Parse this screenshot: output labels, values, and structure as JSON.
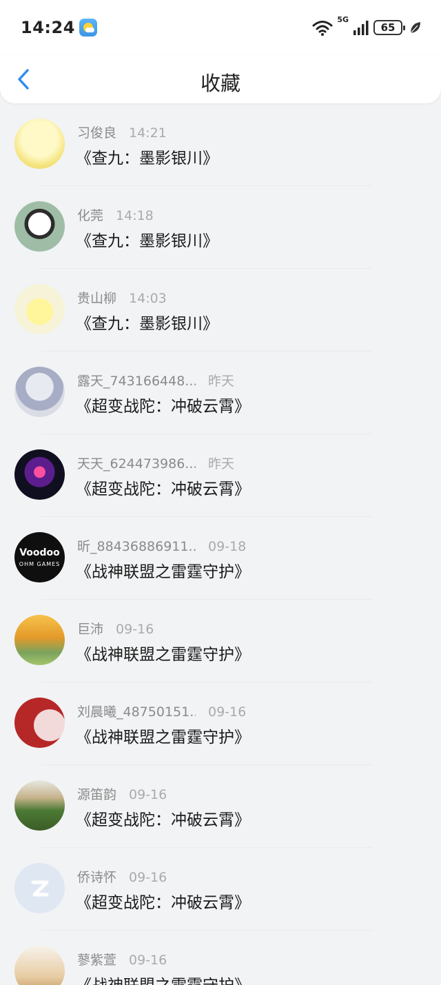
{
  "status_bar": {
    "time": "14:24",
    "weather_icon": "partly-cloudy-icon",
    "network": "5G",
    "battery": "65",
    "icons": [
      "wifi-icon",
      "signal-icon",
      "battery-icon",
      "leaf-icon"
    ]
  },
  "nav": {
    "back_icon": "chevron-left-icon",
    "title": "收藏"
  },
  "colors": {
    "accent": "#2f8cf0",
    "background": "#f2f3f5"
  },
  "items": [
    {
      "name": "习俊良",
      "time": "14:21",
      "title": "《查九：墨影银川》"
    },
    {
      "name": "化莞",
      "time": "14:18",
      "title": "《查九：墨影银川》"
    },
    {
      "name": "贵山柳",
      "time": "14:03",
      "title": "《查九：墨影银川》"
    },
    {
      "name": "露天_743166448...",
      "time": "昨天",
      "title": "《超变战陀：冲破云霄》"
    },
    {
      "name": "天天_624473986...",
      "time": "昨天",
      "title": "《超变战陀：冲破云霄》"
    },
    {
      "name": "昕_88436886911...",
      "time": "09-18",
      "title": "《战神联盟之雷霆守护》",
      "avatar_text": "Voodoo",
      "avatar_subtext": "OHM GAMES"
    },
    {
      "name": "巨沛",
      "time": "09-16",
      "title": "《战神联盟之雷霆守护》"
    },
    {
      "name": "刘晨曦_48750151...",
      "time": "09-16",
      "title": "《战神联盟之雷霆守护》"
    },
    {
      "name": "源笛韵",
      "time": "09-16",
      "title": "《超变战陀：冲破云霄》"
    },
    {
      "name": "侨诗怀",
      "time": "09-16",
      "title": "《超变战陀：冲破云霄》"
    },
    {
      "name": "蓼紫萱",
      "time": "09-16",
      "title": "《战神联盟之雷霆守护》"
    }
  ]
}
